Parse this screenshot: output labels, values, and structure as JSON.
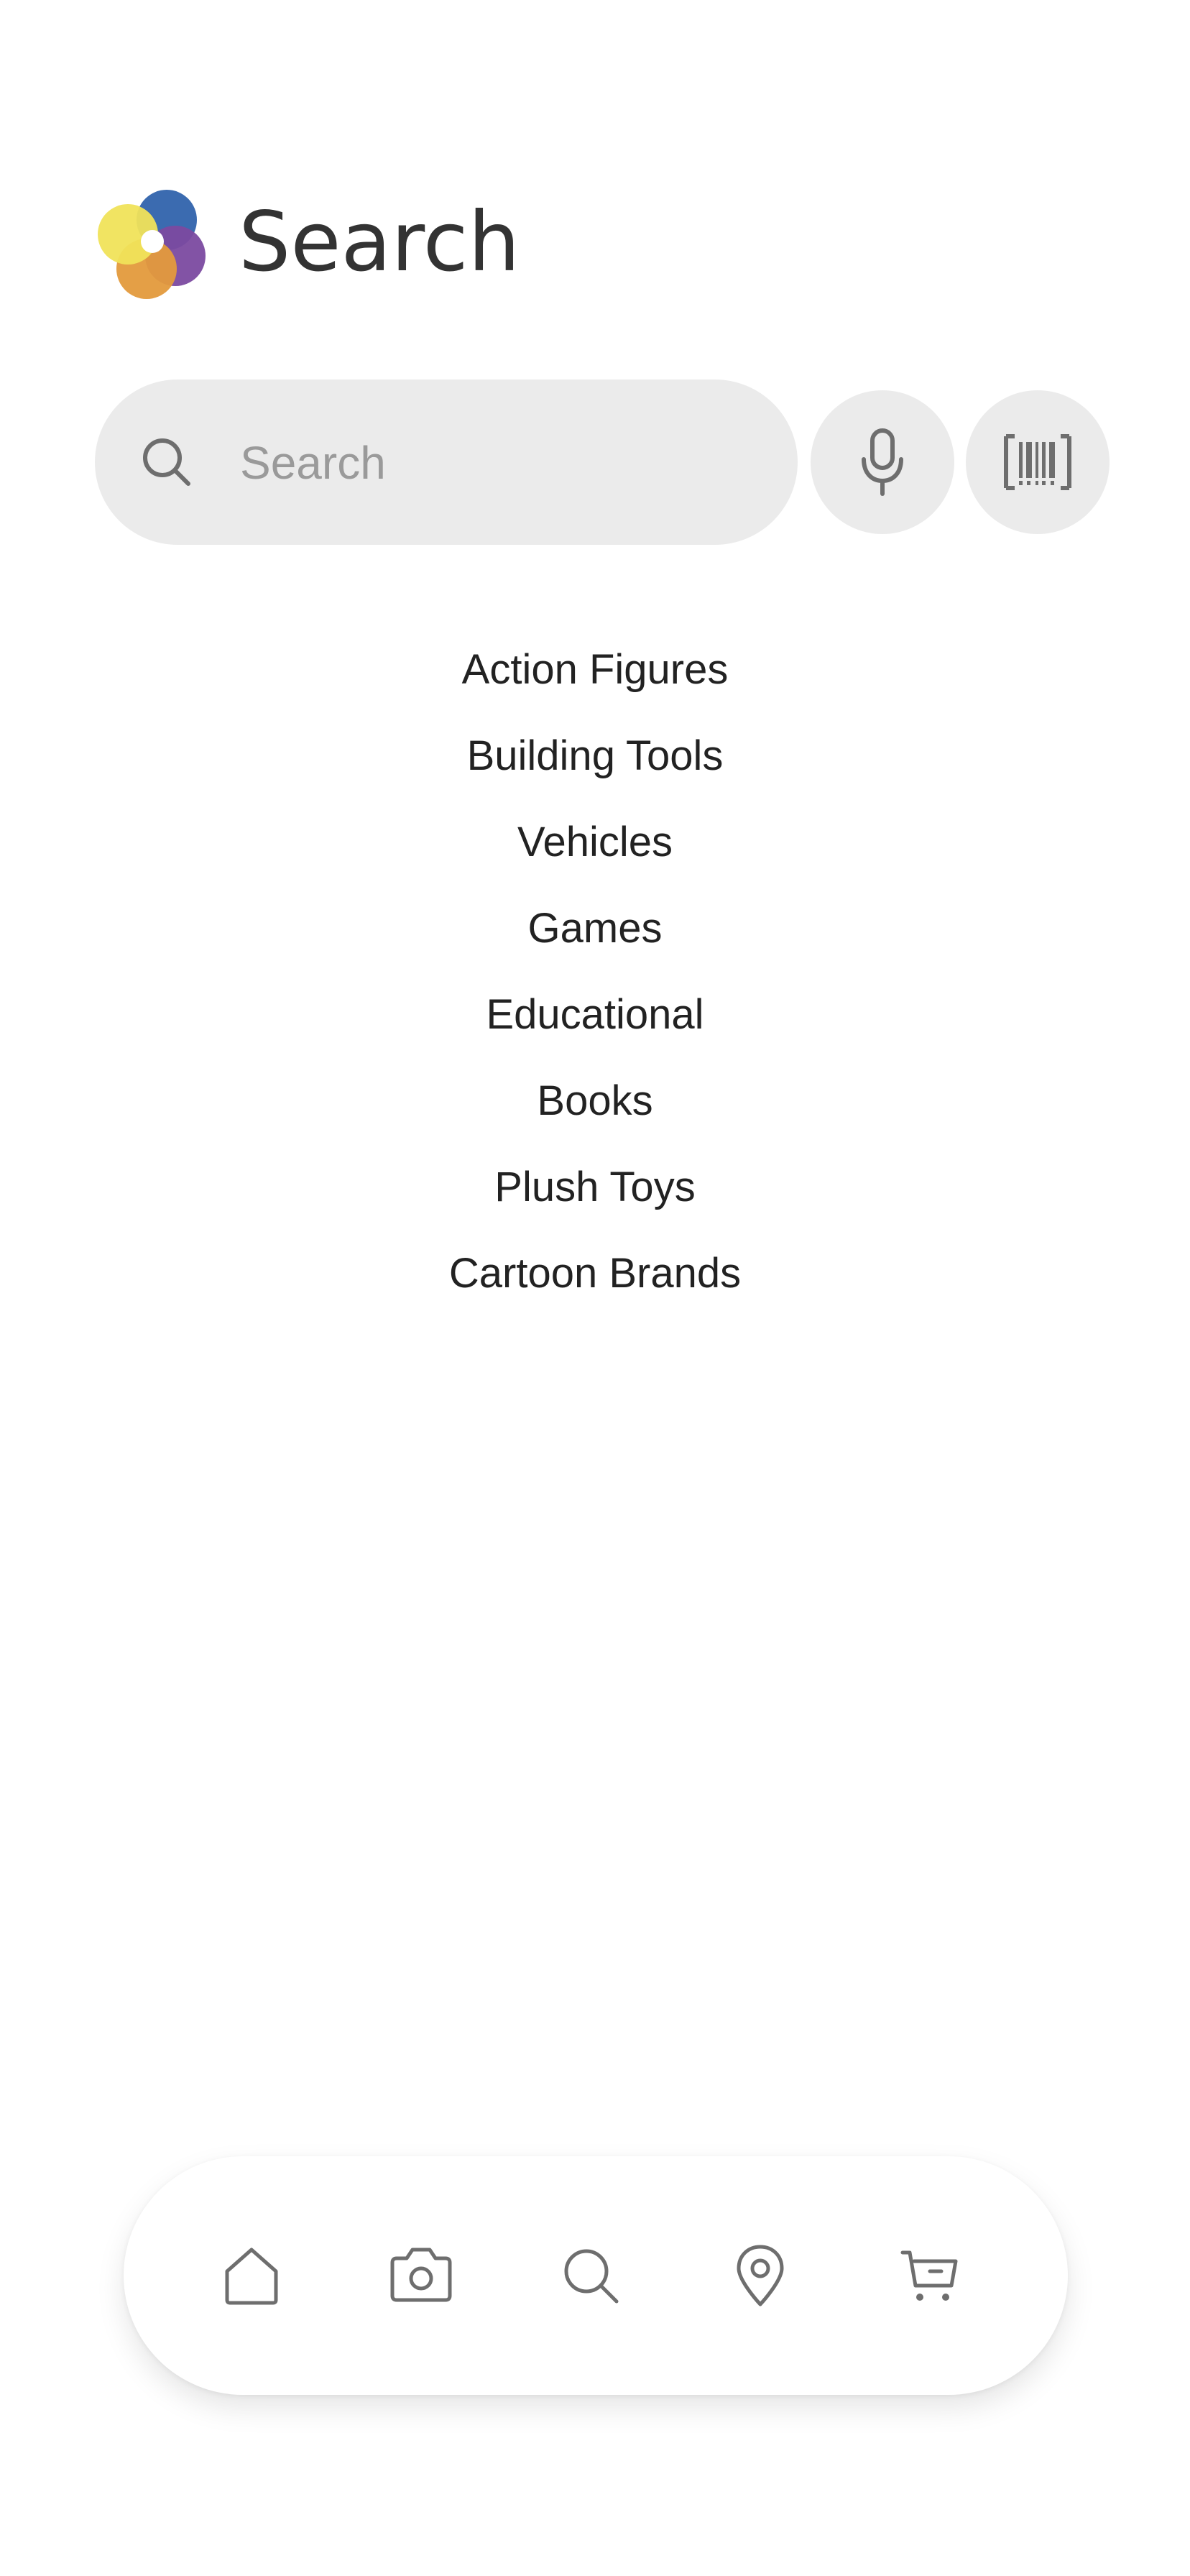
{
  "header": {
    "title": "Search",
    "logo_colors": [
      "#3b6bb0",
      "#7b4aa0",
      "#e39a3c",
      "#f0e35a"
    ]
  },
  "search": {
    "placeholder": "Search",
    "value": ""
  },
  "actions": {
    "icons": [
      "microphone-icon",
      "barcode-icon"
    ]
  },
  "categories": [
    "Action Figures",
    "Building Tools",
    "Vehicles",
    "Games",
    "Educational",
    "Books",
    "Plush Toys",
    "Cartoon Brands"
  ],
  "bottom_nav": {
    "items": [
      "home-icon",
      "camera-icon",
      "search-icon",
      "location-icon",
      "cart-icon"
    ]
  },
  "colors": {
    "surface": "#ebebeb",
    "icon": "#6e6e6e",
    "text": "#222222"
  }
}
